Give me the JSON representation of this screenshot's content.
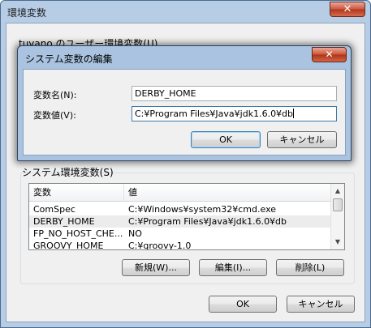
{
  "outer": {
    "title": "環境変数",
    "close_glyph": "✕",
    "user_group_label": "tuyano のユーザー環境変数(U)",
    "system_group_label": "システム環境変数(S)",
    "list": {
      "headers": [
        "変数",
        "値"
      ],
      "rows": [
        {
          "name": "ComSpec",
          "value": "C:¥Windows¥system32¥cmd.exe"
        },
        {
          "name": "DERBY_HOME",
          "value": "C:¥Program Files¥Java¥jdk1.6.0¥db"
        },
        {
          "name": "FP_NO_HOST_CHE...",
          "value": "NO"
        },
        {
          "name": "GROOVY_HOME",
          "value": "C:¥groovy-1.0"
        }
      ],
      "selected_row": 1,
      "scroll_up": "▲",
      "scroll_down": "▼"
    },
    "buttons": {
      "new": "新規(W)...",
      "edit": "編集(I)...",
      "delete": "削除(L)",
      "ok": "OK",
      "cancel": "キャンセル"
    }
  },
  "dialog": {
    "title": "システム変数の編集",
    "close_glyph": "✕",
    "name_label": "変数名(N):",
    "value_label": "変数値(V):",
    "name_value": "DERBY_HOME",
    "value_value": "C:¥Program Files¥Java¥jdk1.6.0¥db",
    "ok": "OK",
    "cancel": "キャンセル"
  }
}
